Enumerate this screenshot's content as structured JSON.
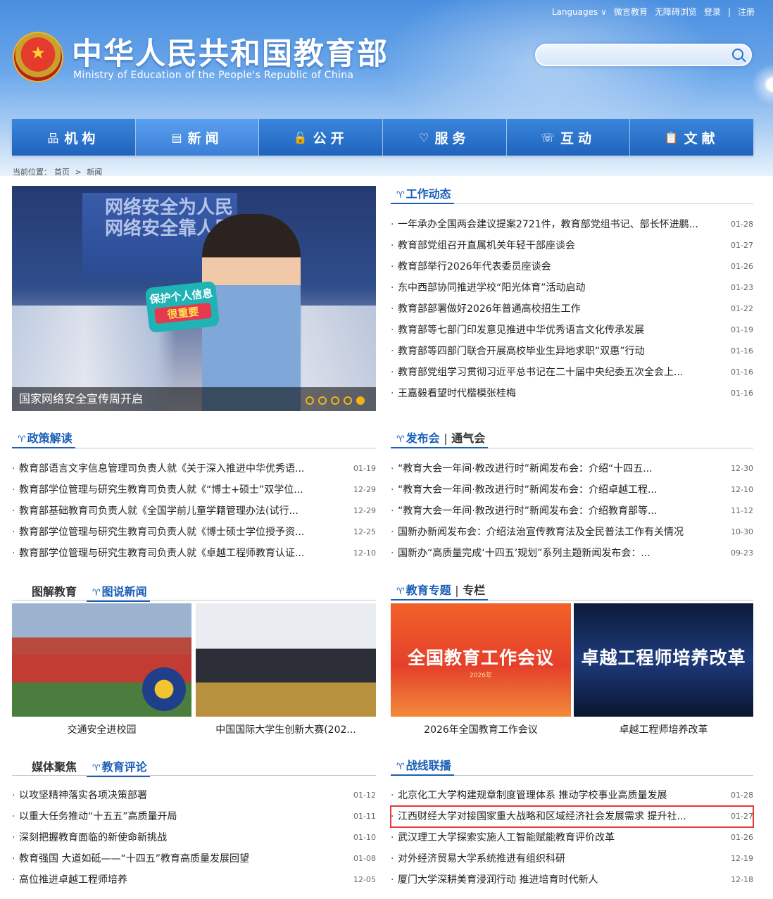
{
  "header": {
    "links": [
      "Languages ∨",
      "微言教育",
      "无障碍浏览",
      "登录",
      "|",
      "注册"
    ],
    "site_name_cn": "中华人民共和国教育部",
    "site_name_en": "Ministry of Education of the People's Republic of China",
    "search_placeholder": ""
  },
  "nav": [
    {
      "icon": "品",
      "label": "机构"
    },
    {
      "icon": "▤",
      "label": "新闻"
    },
    {
      "icon": "🔓",
      "label": "公开"
    },
    {
      "icon": "♡",
      "label": "服务"
    },
    {
      "icon": "☏",
      "label": "互动"
    },
    {
      "icon": "📋",
      "label": "文献"
    }
  ],
  "breadcrumb": {
    "prefix": "当前位置：",
    "home": "首页",
    "sep": ">",
    "current": "新闻"
  },
  "hero": {
    "slogan1": "网络安全为人民",
    "slogan2": "网络安全靠人民",
    "sign1": "保护个人信息",
    "sign2": "很重要",
    "caption": "国家网络安全宣传周开启",
    "slides": 5,
    "active_slide": 5
  },
  "work": {
    "title": "工作动态",
    "items": [
      {
        "text": "一年承办全国两会建议提案2721件，教育部党组书记、部长怀进鹏...",
        "date": "01-28"
      },
      {
        "text": "教育部党组召开直属机关年轻干部座谈会",
        "date": "01-27"
      },
      {
        "text": "教育部举行2026年代表委员座谈会",
        "date": "01-26"
      },
      {
        "text": "东中西部协同推进学校“阳光体育”活动启动",
        "date": "01-23"
      },
      {
        "text": "教育部部署做好2026年普通高校招生工作",
        "date": "01-22"
      },
      {
        "text": "教育部等七部门印发意见推进中华优秀语言文化传承发展",
        "date": "01-19"
      },
      {
        "text": "教育部等四部门联合开展高校毕业生异地求职“双惠”行动",
        "date": "01-16"
      },
      {
        "text": "教育部党组学习贯彻习近平总书记在二十届中央纪委五次全会上...",
        "date": "01-16"
      },
      {
        "text": "王嘉毅看望时代楷模张桂梅",
        "date": "01-16"
      }
    ]
  },
  "policy": {
    "title": "政策解读",
    "items": [
      {
        "text": "教育部语言文字信息管理司负责人就《关于深入推进中华优秀语...",
        "date": "01-19"
      },
      {
        "text": "教育部学位管理与研究生教育司负责人就《“博士+硕士”双学位...",
        "date": "12-29"
      },
      {
        "text": "教育部基础教育司负责人就《全国学前儿童学籍管理办法(试行...",
        "date": "12-29"
      },
      {
        "text": "教育部学位管理与研究生教育司负责人就《博士硕士学位授予资...",
        "date": "12-25"
      },
      {
        "text": "教育部学位管理与研究生教育司负责人就《卓越工程师教育认证...",
        "date": "12-10"
      }
    ]
  },
  "press": {
    "title": "发布会",
    "sep": "|",
    "sub": "通气会",
    "items": [
      {
        "text": "“教育大会一年间·教改进行时”新闻发布会：介绍“十四五...",
        "date": "12-30"
      },
      {
        "text": "“教育大会一年间·教改进行时”新闻发布会：介绍卓越工程...",
        "date": "12-10"
      },
      {
        "text": "“教育大会一年间·教改进行时”新闻发布会：介绍教育部等...",
        "date": "11-12"
      },
      {
        "text": "国新办新闻发布会：介绍法治宣传教育法及全民普法工作有关情况",
        "date": "10-30"
      },
      {
        "text": "国新办“高质量完成‘十四五’规划”系列主题新闻发布会：...",
        "date": "09-23"
      }
    ]
  },
  "pictures": {
    "tab_inactive": "图解教育",
    "tab_active": "图说新闻",
    "items": [
      {
        "caption": "交通安全进校园"
      },
      {
        "caption": "中国国际大学生创新大赛(202..."
      }
    ]
  },
  "topics": {
    "title": "教育专题",
    "sep": "|",
    "sub": "专栏",
    "items": [
      {
        "caption": "2026年全国教育工作会议",
        "img_text": "全国教育工作会议",
        "img_year": "2026年"
      },
      {
        "caption": "卓越工程师培养改革",
        "img_text": "卓越工程师培养改革"
      }
    ]
  },
  "media": {
    "tab_inactive": "媒体聚焦",
    "tab_active": "教育评论",
    "items": [
      {
        "text": "以攻坚精神落实各项决策部署",
        "date": "01-12"
      },
      {
        "text": "以重大任务推动“十五五”高质量开局",
        "date": "01-11"
      },
      {
        "text": "深刻把握教育面临的新使命新挑战",
        "date": "01-10"
      },
      {
        "text": "教育强国 大道如砥——“十四五”教育高质量发展回望",
        "date": "01-08"
      },
      {
        "text": "高位推进卓越工程师培养",
        "date": "12-05"
      }
    ]
  },
  "front": {
    "title": "战线联播",
    "items": [
      {
        "text": "北京化工大学构建规章制度管理体系 推动学校事业高质量发展",
        "date": "01-28"
      },
      {
        "text": "江西财经大学对接国家重大战略和区域经济社会发展需求 提升社...",
        "date": "01-27"
      },
      {
        "text": "武汉理工大学探索实施人工智能赋能教育评价改革",
        "date": "01-26"
      },
      {
        "text": "对外经济贸易大学系统推进有组织科研",
        "date": "12-19"
      },
      {
        "text": "厦门大学深耕美育浸润行动 推进培育时代新人",
        "date": "12-18"
      }
    ]
  }
}
